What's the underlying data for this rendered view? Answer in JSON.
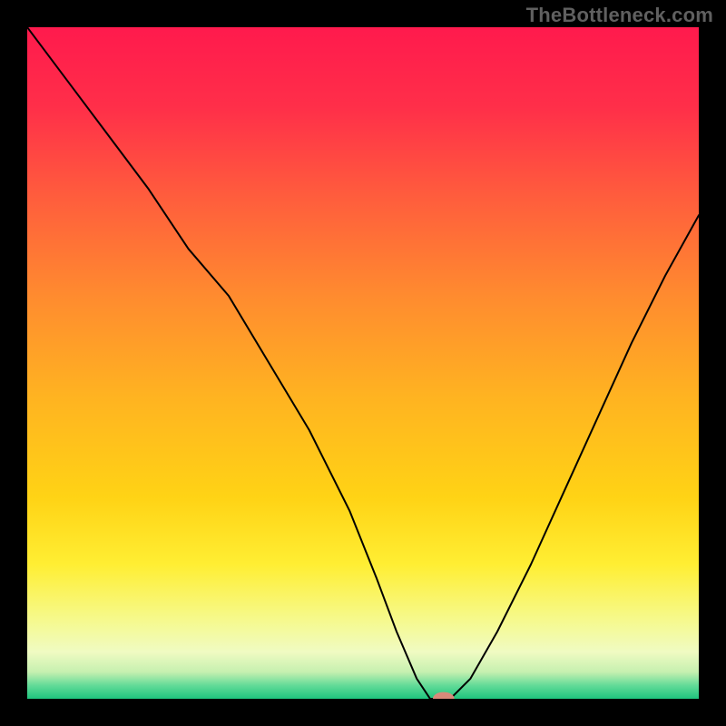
{
  "watermark": "TheBottleneck.com",
  "chart_data": {
    "type": "line",
    "title": "",
    "xlabel": "",
    "ylabel": "",
    "xlim": [
      0,
      100
    ],
    "ylim": [
      0,
      100
    ],
    "background": {
      "type": "vertical_gradient",
      "stops": [
        {
          "y": 0,
          "color": "#ff1a4d"
        },
        {
          "y": 12,
          "color": "#ff2f49"
        },
        {
          "y": 25,
          "color": "#ff5c3d"
        },
        {
          "y": 40,
          "color": "#ff8b2f"
        },
        {
          "y": 55,
          "color": "#ffb321"
        },
        {
          "y": 70,
          "color": "#ffd315"
        },
        {
          "y": 80,
          "color": "#ffee33"
        },
        {
          "y": 88,
          "color": "#f6f98a"
        },
        {
          "y": 93,
          "color": "#f0fbc2"
        },
        {
          "y": 96,
          "color": "#c6f0b0"
        },
        {
          "y": 98,
          "color": "#63db98"
        },
        {
          "y": 100,
          "color": "#1ec47e"
        }
      ]
    },
    "series": [
      {
        "name": "bottleneck_curve",
        "color": "#000000",
        "width": 2,
        "x": [
          0,
          6,
          12,
          18,
          24,
          30,
          36,
          42,
          48,
          52,
          55,
          58,
          60,
          63,
          66,
          70,
          75,
          80,
          85,
          90,
          95,
          100
        ],
        "y": [
          100,
          92,
          84,
          76,
          67,
          60,
          50,
          40,
          28,
          18,
          10,
          3,
          0,
          0,
          3,
          10,
          20,
          31,
          42,
          53,
          63,
          72
        ]
      }
    ],
    "marker": {
      "name": "selected_point",
      "x": 62,
      "y": 0,
      "color": "#d88a7a",
      "rx": 1.6,
      "ry": 1.0
    }
  }
}
